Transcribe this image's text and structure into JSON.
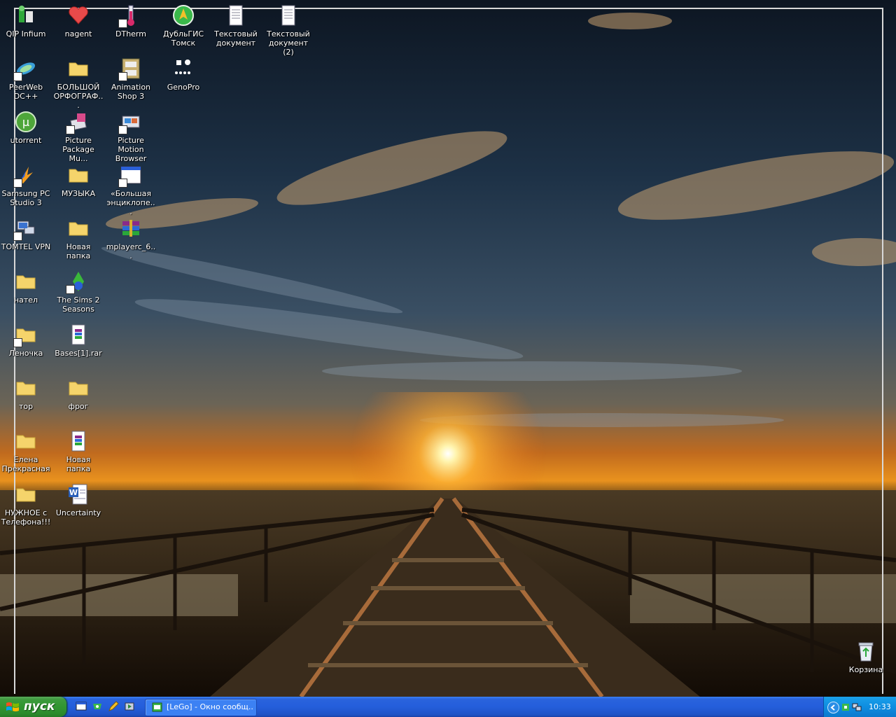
{
  "desktop": {
    "icons": [
      {
        "label": "QIP Infium"
      },
      {
        "label": "nagent"
      },
      {
        "label": "DTherm"
      },
      {
        "label": "ДубльГИС Томск"
      },
      {
        "label": "Текстовый документ"
      },
      {
        "label": "Текстовый документ (2)"
      },
      {
        "label": "PeerWeb DC++"
      },
      {
        "label": "БОЛЬШОЙ ОРФОГРАФ..."
      },
      {
        "label": "Animation Shop 3"
      },
      {
        "label": "GenoPro"
      },
      {
        "label": "utorrent"
      },
      {
        "label": "Picture Package Mu..."
      },
      {
        "label": "Picture Motion Browser"
      },
      {
        "label": "Samsung PC Studio 3"
      },
      {
        "label": "МУЗЫКА"
      },
      {
        "label": "«Большая энциклопе..."
      },
      {
        "label": "TOMTEL VPN"
      },
      {
        "label": "Новая папка"
      },
      {
        "label": "mplayerc_6..."
      },
      {
        "label": "нател"
      },
      {
        "label": "The Sims 2 Seasons"
      },
      {
        "label": "Леночка"
      },
      {
        "label": "Bases[1].rar"
      },
      {
        "label": "тор"
      },
      {
        "label": "фрог"
      },
      {
        "label": "Елена Прекрасная"
      },
      {
        "label": "Новая папка"
      },
      {
        "label": "НУЖНОЕ с Телефона!!!"
      },
      {
        "label": "Uncertainty"
      },
      {
        "label": "Корзина"
      }
    ]
  },
  "taskbar": {
    "start_label": "пуск",
    "task_label": "[LeGo] - Окно сообщ...",
    "clock": "10:33"
  }
}
